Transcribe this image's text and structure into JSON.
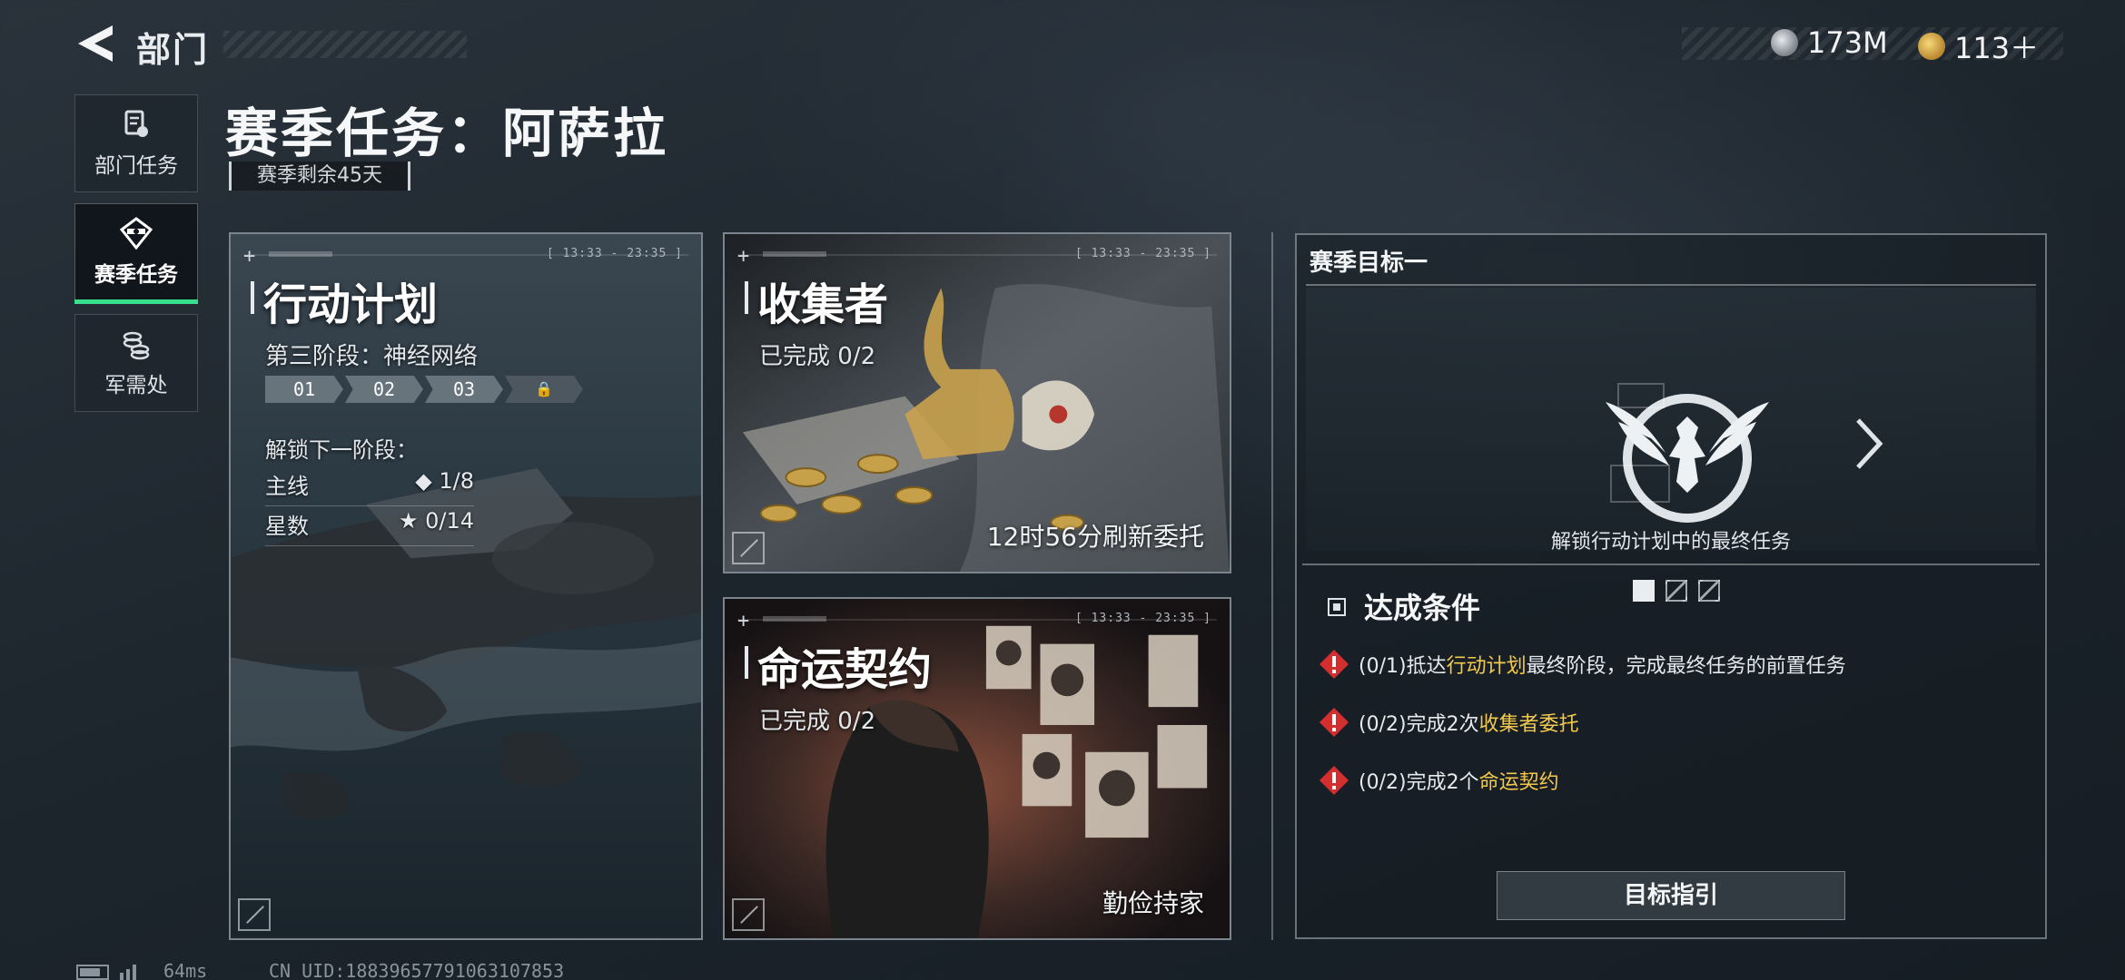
{
  "header": {
    "title": "部门",
    "currencies": [
      {
        "icon": "silver-coin-icon",
        "value": "173M"
      },
      {
        "icon": "gold-coin-icon",
        "value": "113＋"
      }
    ]
  },
  "nav": [
    {
      "label": "部门任务",
      "icon": "document-icon",
      "active": false
    },
    {
      "label": "赛季任务",
      "icon": "season-icon",
      "active": true
    },
    {
      "label": "军需处",
      "icon": "coins-icon",
      "active": false
    }
  ],
  "page": {
    "title": "赛季任务：阿萨拉",
    "season_remaining": "赛季剩余45天"
  },
  "cards": {
    "plan": {
      "time": "[ 13:33 - 23:35 ]",
      "title": "行动计划",
      "phase": "第三阶段：神经网络",
      "stages": [
        "01",
        "02",
        "03"
      ],
      "unlock_label": "解锁下一阶段：",
      "main_label": "主线",
      "main_value": "◆ 1/8",
      "stars_label": "星数",
      "stars_value": "★ 0/14"
    },
    "collector": {
      "time": "[ 13:33 - 23:35 ]",
      "title": "收集者",
      "progress": "已完成 0/2",
      "refresh": "12时56分刷新委托"
    },
    "fate": {
      "time": "[ 13:33 - 23:35 ]",
      "title": "命运契约",
      "progress": "已完成 0/2",
      "footer": "勤俭持家"
    }
  },
  "goal": {
    "title": "赛季目标一",
    "description": "解锁行动计划中的最终任务",
    "conditions_title": "达成条件",
    "conditions": [
      {
        "prefix": "(0/1)抵达",
        "highlight": "行动计划",
        "suffix": "最终阶段，完成最终任务的前置任务"
      },
      {
        "prefix": "(0/2)完成2次",
        "highlight": "收集者委托",
        "suffix": ""
      },
      {
        "prefix": "(0/2)完成2个",
        "highlight": "命运契约",
        "suffix": ""
      }
    ],
    "guide_button": "目标指引"
  },
  "status": {
    "ping": "64ms",
    "uid": "CN UID:18839657791063107853"
  }
}
